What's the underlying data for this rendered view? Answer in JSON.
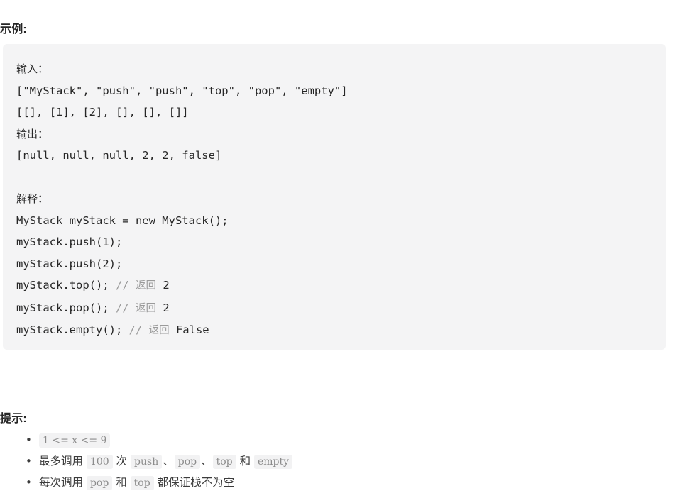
{
  "sections": {
    "example": {
      "heading": "示例:",
      "code_lines": [
        {
          "kind": "cjk",
          "text": "输入："
        },
        {
          "kind": "code",
          "text": "[\"MyStack\", \"push\", \"push\", \"top\", \"pop\", \"empty\"]"
        },
        {
          "kind": "code",
          "text": "[[], [1], [2], [], [], []]"
        },
        {
          "kind": "cjk",
          "text": "输出："
        },
        {
          "kind": "code",
          "text": "[null, null, null, 2, 2, false]"
        },
        {
          "kind": "blank",
          "text": ""
        },
        {
          "kind": "cjk",
          "text": "解释："
        },
        {
          "kind": "code",
          "text": "MyStack myStack = new MyStack();"
        },
        {
          "kind": "code",
          "text": "myStack.push(1);"
        },
        {
          "kind": "code",
          "text": "myStack.push(2);"
        },
        {
          "kind": "comment",
          "code": "myStack.top(); ",
          "marker": "// ",
          "note": "返回",
          "value": " 2"
        },
        {
          "kind": "comment",
          "code": "myStack.pop(); ",
          "marker": "// ",
          "note": "返回",
          "value": " 2"
        },
        {
          "kind": "comment",
          "code": "myStack.empty(); ",
          "marker": "// ",
          "note": "返回",
          "value": " False"
        }
      ]
    },
    "hints": {
      "heading": "提示:",
      "items": [
        {
          "bullet": "•",
          "parts": [
            {
              "type": "code",
              "text": "1 <= x <= 9"
            }
          ]
        },
        {
          "bullet": "•",
          "parts": [
            {
              "type": "text",
              "text": "最多调用 "
            },
            {
              "type": "code",
              "text": "100"
            },
            {
              "type": "text",
              "text": " 次 "
            },
            {
              "type": "code",
              "text": "push"
            },
            {
              "type": "sep",
              "text": "、"
            },
            {
              "type": "code",
              "text": "pop"
            },
            {
              "type": "sep",
              "text": "、"
            },
            {
              "type": "code",
              "text": "top"
            },
            {
              "type": "text",
              "text": " 和 "
            },
            {
              "type": "code",
              "text": "empty"
            }
          ]
        },
        {
          "bullet": "•",
          "parts": [
            {
              "type": "text",
              "text": "每次调用 "
            },
            {
              "type": "code",
              "text": "pop"
            },
            {
              "type": "text",
              "text": " 和 "
            },
            {
              "type": "code",
              "text": "top"
            },
            {
              "type": "text",
              "text": " 都保证栈不为空"
            }
          ]
        }
      ]
    }
  },
  "colors": {
    "code_block_bg": "#f4f4f5",
    "inline_code_bg": "#f2f2f3",
    "inline_code_text": "#8c8c8c",
    "code_text": "#262626",
    "comment_text": "#9a9a9a",
    "heading_text": "#262626",
    "body_text": "#3c3c3c",
    "page_bg": "#ffffff"
  }
}
